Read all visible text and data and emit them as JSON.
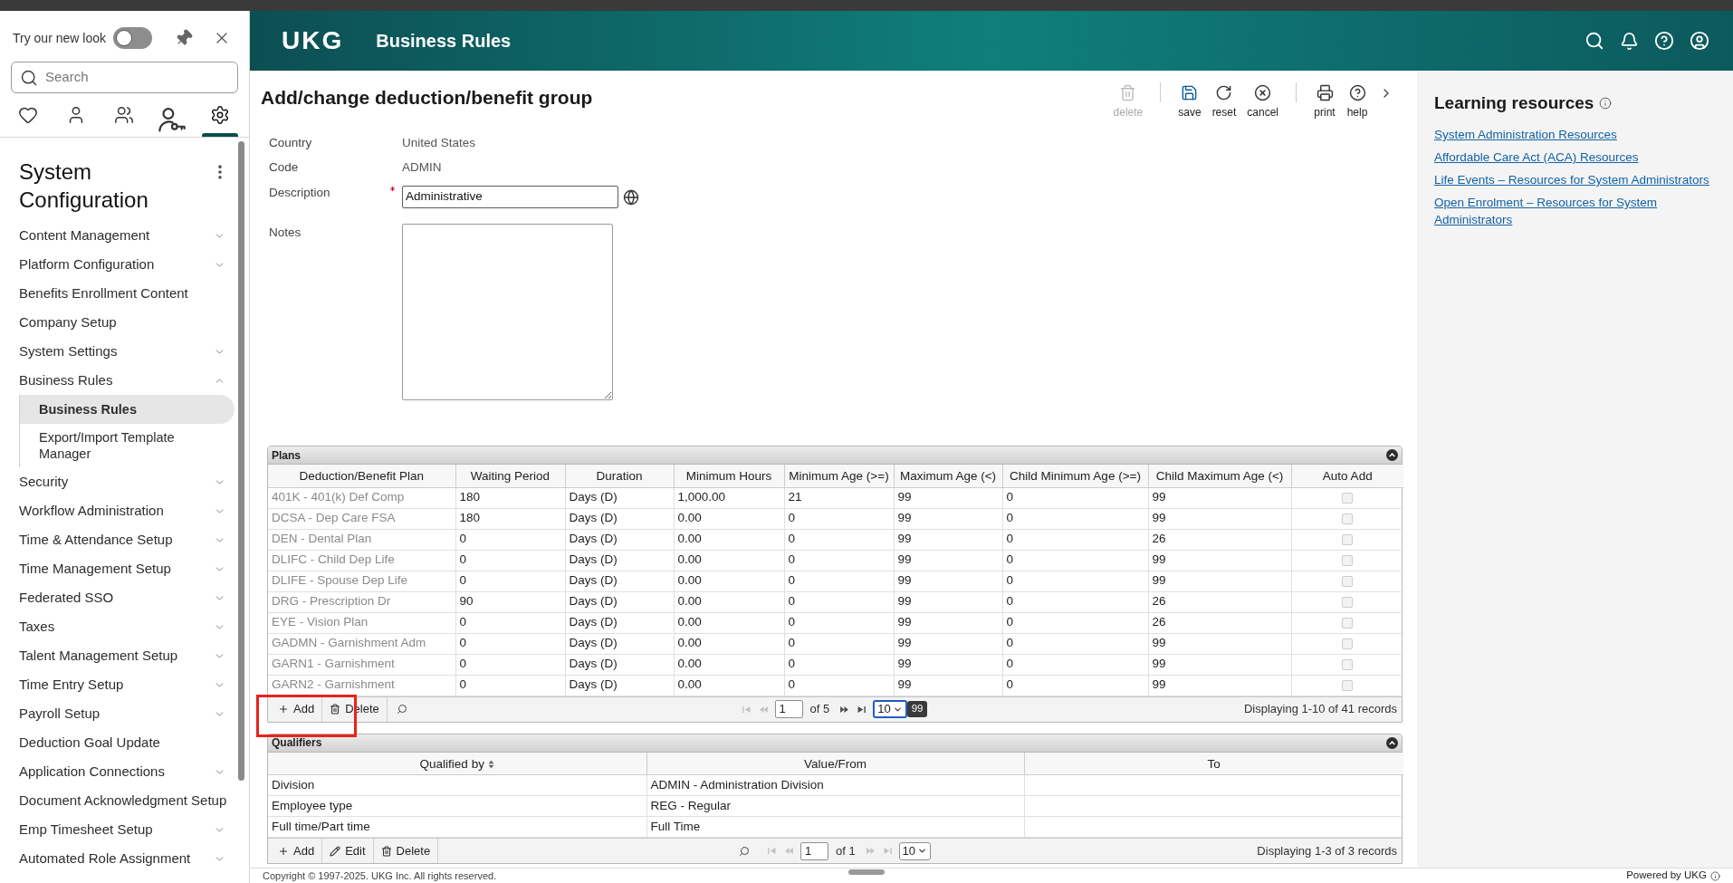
{
  "sidebar": {
    "new_look": {
      "label": "Try our new look",
      "on": false
    },
    "search": {
      "placeholder": "Search"
    },
    "icon_tabs": [
      {
        "selected": false
      },
      {
        "selected": false
      },
      {
        "selected": false
      },
      {
        "selected": false
      },
      {
        "selected": true
      }
    ],
    "title": "System Configuration",
    "items": [
      {
        "label": "Content Management",
        "expandable": true,
        "expanded": false,
        "selected": false
      },
      {
        "label": "Platform Configuration",
        "expandable": true,
        "expanded": false,
        "selected": false
      },
      {
        "label": "Benefits Enrollment Content",
        "expandable": false,
        "expanded": false,
        "selected": false
      },
      {
        "label": "Company Setup",
        "expandable": false,
        "expanded": false,
        "selected": false
      },
      {
        "label": "System Settings",
        "expandable": true,
        "expanded": false,
        "selected": false
      },
      {
        "label": "Business Rules",
        "expandable": true,
        "expanded": true,
        "selected": false,
        "children": [
          {
            "label": "Business Rules",
            "selected": true
          },
          {
            "label": "Export/Import Template Manager",
            "selected": false
          }
        ]
      },
      {
        "label": "Security",
        "expandable": true,
        "expanded": false,
        "selected": false
      },
      {
        "label": "Workflow Administration",
        "expandable": true,
        "expanded": false,
        "selected": false
      },
      {
        "label": "Time & Attendance Setup",
        "expandable": true,
        "expanded": false,
        "selected": false
      },
      {
        "label": "Time Management Setup",
        "expandable": true,
        "expanded": false,
        "selected": false
      },
      {
        "label": "Federated SSO",
        "expandable": true,
        "expanded": false,
        "selected": false
      },
      {
        "label": "Taxes",
        "expandable": true,
        "expanded": false,
        "selected": false
      },
      {
        "label": "Talent Management Setup",
        "expandable": true,
        "expanded": false,
        "selected": false
      },
      {
        "label": "Time Entry Setup",
        "expandable": true,
        "expanded": false,
        "selected": false
      },
      {
        "label": "Payroll Setup",
        "expandable": true,
        "expanded": false,
        "selected": false
      },
      {
        "label": "Deduction Goal Update",
        "expandable": false,
        "expanded": false,
        "selected": false
      },
      {
        "label": "Application Connections",
        "expandable": true,
        "expanded": false,
        "selected": false
      },
      {
        "label": "Document Acknowledgment Setup",
        "expandable": false,
        "expanded": false,
        "selected": false
      },
      {
        "label": "Emp Timesheet Setup",
        "expandable": true,
        "expanded": false,
        "selected": false
      },
      {
        "label": "Automated Role Assignment",
        "expandable": true,
        "expanded": false,
        "selected": false
      }
    ]
  },
  "header": {
    "logo": "UKG",
    "title": "Business Rules"
  },
  "page": {
    "title": "Add/change deduction/benefit group",
    "toolbar": [
      {
        "buttons": [
          {
            "label": "delete",
            "disabled": true
          }
        ]
      },
      {
        "buttons": [
          {
            "label": "save",
            "disabled": false
          },
          {
            "label": "reset",
            "disabled": false
          },
          {
            "label": "cancel",
            "disabled": false
          }
        ]
      },
      {
        "buttons": [
          {
            "label": "print",
            "disabled": false
          },
          {
            "label": "help",
            "disabled": false
          }
        ]
      }
    ],
    "fields": [
      {
        "label": "Country",
        "kind": "text",
        "value": "United States"
      },
      {
        "label": "Code",
        "kind": "text",
        "value": "ADMIN"
      },
      {
        "label": "Description",
        "kind": "input",
        "required": true,
        "value": "Administrative"
      },
      {
        "label": "Notes",
        "kind": "textarea"
      }
    ],
    "plans": {
      "title": "Plans",
      "columns": [
        {
          "label": "Deduction/Benefit Plan",
          "sortable": false
        },
        {
          "label": "Waiting Period",
          "sortable": false
        },
        {
          "label": "Duration",
          "sortable": false
        },
        {
          "label": "Minimum Hours",
          "sortable": false
        },
        {
          "label": "Minimum Age (>=)",
          "sortable": false
        },
        {
          "label": "Maximum Age (<)",
          "sortable": false
        },
        {
          "label": "Child Minimum Age (>=)",
          "sortable": false
        },
        {
          "label": "Child Maximum Age (<)",
          "sortable": false
        },
        {
          "label": "Auto Add",
          "sortable": false
        }
      ],
      "rows": [
        {
          "cells": [
            "401K - 401(k) Def Comp",
            "180",
            "Days (D)",
            "1,000.00",
            "21",
            "99",
            "0",
            "99"
          ],
          "auto_add": {
            "checked": false,
            "disabled": true
          }
        },
        {
          "cells": [
            "DCSA - Dep Care FSA",
            "180",
            "Days (D)",
            "0.00",
            "0",
            "99",
            "0",
            "99"
          ],
          "auto_add": {
            "checked": false,
            "disabled": true
          }
        },
        {
          "cells": [
            "DEN - Dental Plan",
            "0",
            "Days (D)",
            "0.00",
            "0",
            "99",
            "0",
            "26"
          ],
          "auto_add": {
            "checked": false,
            "disabled": true
          }
        },
        {
          "cells": [
            "DLIFC - Child Dep Life",
            "0",
            "Days (D)",
            "0.00",
            "0",
            "99",
            "0",
            "99"
          ],
          "auto_add": {
            "checked": false,
            "disabled": true
          }
        },
        {
          "cells": [
            "DLIFE - Spouse Dep Life",
            "0",
            "Days (D)",
            "0.00",
            "0",
            "99",
            "0",
            "99"
          ],
          "auto_add": {
            "checked": false,
            "disabled": true
          }
        },
        {
          "cells": [
            "DRG - Prescription Dr",
            "90",
            "Days (D)",
            "0.00",
            "0",
            "99",
            "0",
            "26"
          ],
          "auto_add": {
            "checked": false,
            "disabled": true
          }
        },
        {
          "cells": [
            "EYE - Vision Plan",
            "0",
            "Days (D)",
            "0.00",
            "0",
            "99",
            "0",
            "26"
          ],
          "auto_add": {
            "checked": false,
            "disabled": true
          }
        },
        {
          "cells": [
            "GADMN - Garnishment Adm",
            "0",
            "Days (D)",
            "0.00",
            "0",
            "99",
            "0",
            "99"
          ],
          "auto_add": {
            "checked": false,
            "disabled": true
          }
        },
        {
          "cells": [
            "GARN1 - Garnishment",
            "0",
            "Days (D)",
            "0.00",
            "0",
            "99",
            "0",
            "99"
          ],
          "auto_add": {
            "checked": false,
            "disabled": true
          }
        },
        {
          "cells": [
            "GARN2 - Garnishment",
            "0",
            "Days (D)",
            "0.00",
            "0",
            "99",
            "0",
            "99"
          ],
          "auto_add": {
            "checked": false,
            "disabled": true
          }
        }
      ],
      "footer": {
        "actions": [
          {
            "label": "Add",
            "kind": "add",
            "highlighted": true
          },
          {
            "label": "Delete",
            "kind": "delete",
            "highlighted": false
          }
        ],
        "pager": {
          "nav": [
            {
              "disabled": true
            },
            {
              "disabled": true
            },
            {
              "disabled": false
            },
            {
              "disabled": false
            }
          ],
          "page": "1",
          "of": "of 5",
          "page_size": "10",
          "focused": true,
          "tooltip": "99"
        },
        "status": "Displaying 1-10 of 41 records"
      }
    },
    "qualifiers": {
      "title": "Qualifiers",
      "columns": [
        {
          "label": "Qualified by",
          "sortable": true
        },
        {
          "label": "Value/From",
          "sortable": false
        },
        {
          "label": "To",
          "sortable": false
        }
      ],
      "rows": [
        {
          "cells": [
            "Division",
            "ADMIN - Administration Division"
          ]
        },
        {
          "cells": [
            "Employee type",
            "REG - Regular"
          ]
        },
        {
          "cells": [
            "Full time/Part time",
            "Full Time"
          ]
        }
      ],
      "footer": {
        "actions": [
          {
            "label": "Add",
            "kind": "add",
            "highlighted": false
          },
          {
            "label": "Edit",
            "kind": "edit",
            "highlighted": false
          },
          {
            "label": "Delete",
            "kind": "delete",
            "highlighted": false
          }
        ],
        "pager": {
          "nav": [
            {
              "disabled": true
            },
            {
              "disabled": true
            },
            {
              "disabled": true
            },
            {
              "disabled": true
            }
          ],
          "page": "1",
          "of": "of 1",
          "page_size": "10",
          "focused": false
        },
        "status": "Displaying 1-3 of 3 records"
      }
    }
  },
  "learning": {
    "title": "Learning resources",
    "links": [
      "System Administration Resources",
      "Affordable Care Act (ACA) Resources",
      "Life Events – Resources for System Administrators",
      "Open Enrolment – Resources for System Administrators"
    ]
  },
  "footer": {
    "copyright": "Copyright © 1997-2025. UKG Inc. All rights reserved.",
    "powered_by": "Powered by UKG"
  }
}
